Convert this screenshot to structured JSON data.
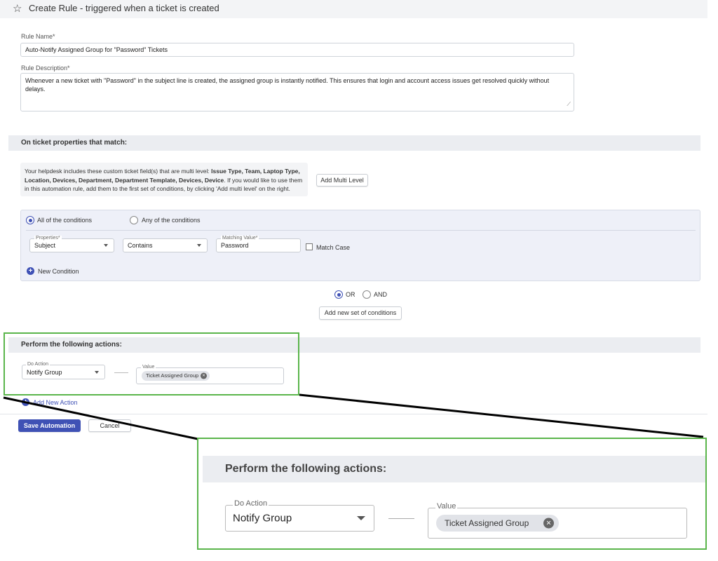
{
  "header": {
    "title": "Create Rule - triggered when a ticket is created",
    "icon": "star-outline-icon"
  },
  "rule_name": {
    "label": "Rule Name*",
    "value": "Auto-Notify Assigned Group for \"Password\" Tickets"
  },
  "rule_description": {
    "label": "Rule Description*",
    "value": "Whenever a new ticket with \"Password\" in the subject line is created, the assigned group is instantly notified. This ensures that login and account access issues get resolved quickly without delays."
  },
  "match_section": {
    "title": "On ticket properties that match:"
  },
  "notice": {
    "text_1": "Your helpdesk includes these custom ticket field(s) that are multi level: ",
    "fields": "Issue Type, Team, Laptop Type, Location, Devices, Department, Department Template, Devices, Device",
    "text_2": ". If you would like to use them in this automation rule, add them to the first set of conditions, by clicking 'Add multi level' on the right."
  },
  "add_multi_level_label": "Add Multi Level",
  "conditions": {
    "all_label": "All of the conditions",
    "any_label": "Any of the conditions",
    "selected": "all",
    "properties_label": "Properties*",
    "properties_value": "Subject",
    "operator_value": "Contains",
    "matching_label": "Matching Value*",
    "matching_value": "Password",
    "match_case_label": "Match Case",
    "match_case_checked": false,
    "new_condition_label": "New Condition"
  },
  "logic": {
    "or_label": "OR",
    "and_label": "AND",
    "selected": "OR"
  },
  "add_condition_set_label": "Add new set of conditions",
  "actions": {
    "title": "Perform the following actions:",
    "do_action_label": "Do Action",
    "do_action_value": "Notify Group",
    "value_label": "Value",
    "value_chip": "Ticket Assigned Group",
    "add_new_action_label": "Add New Action"
  },
  "footer": {
    "save_label": "Save Automation",
    "cancel_label": "Cancel"
  },
  "zoom": {
    "title": "Perform the following actions:",
    "do_action_label": "Do Action",
    "do_action_value": "Notify Group",
    "value_label": "Value",
    "value_chip": "Ticket Assigned Group"
  },
  "colors": {
    "primary": "#3f51b5",
    "highlight": "#5ab54b",
    "section_bg": "#ebedf1"
  }
}
